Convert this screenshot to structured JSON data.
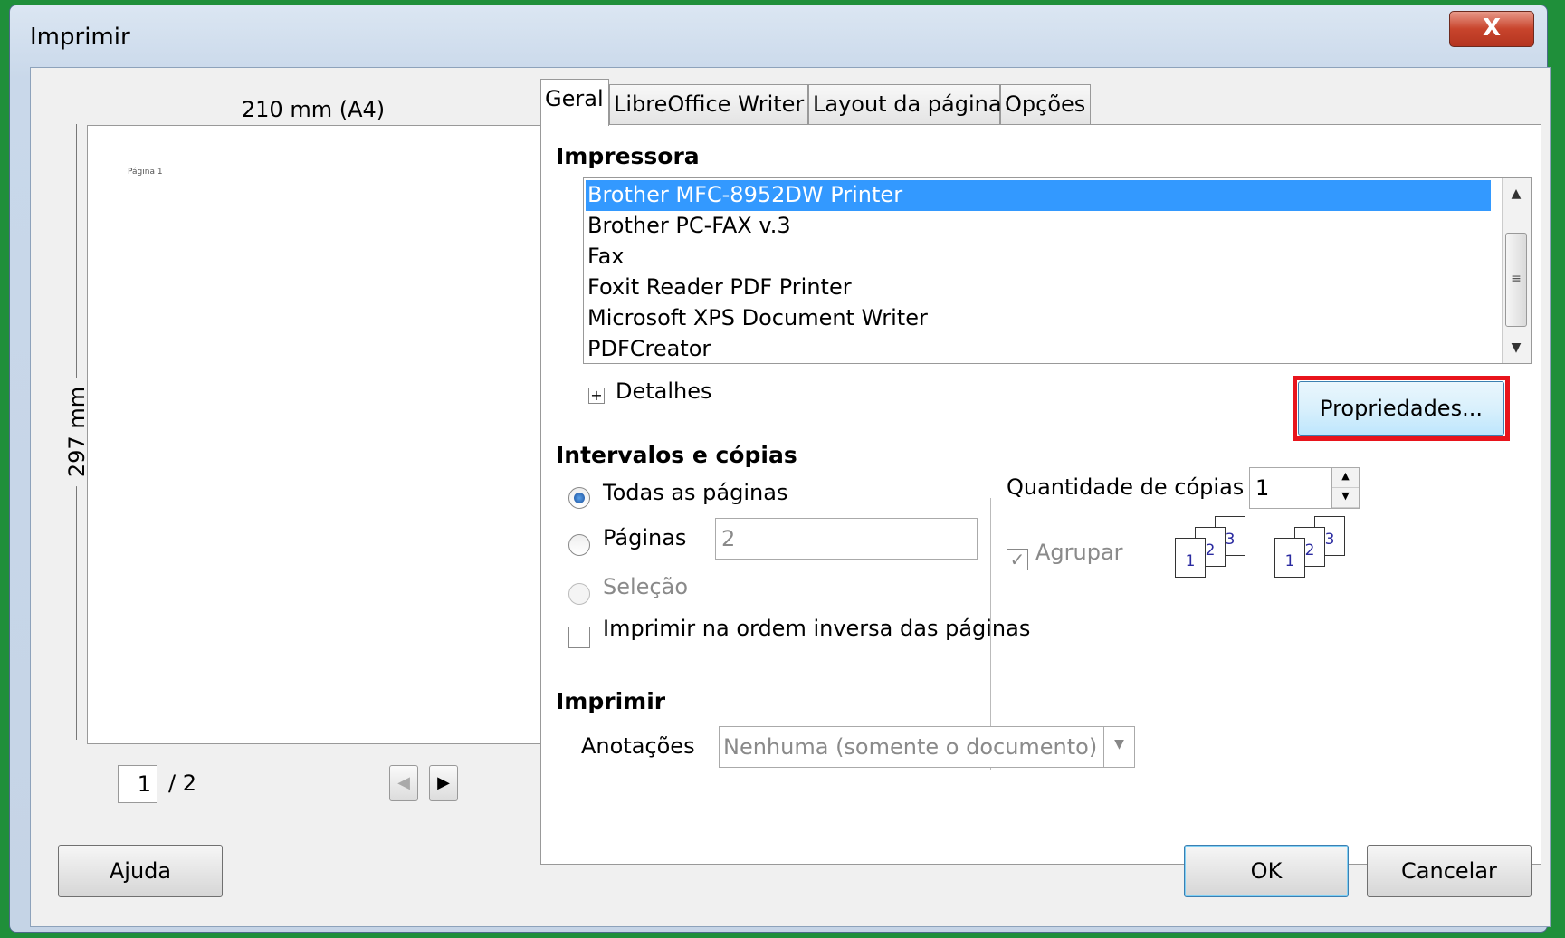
{
  "window": {
    "title": "Imprimir",
    "close_label": "X"
  },
  "preview": {
    "width_label": "210 mm (A4)",
    "height_label": "297 mm",
    "page_text": "Página 1",
    "current_page": "1",
    "total_pages": "/ 2"
  },
  "tabs": [
    {
      "label": "Geral"
    },
    {
      "label": "LibreOffice Writer"
    },
    {
      "label": "Layout da página"
    },
    {
      "label": "Opções"
    }
  ],
  "printer": {
    "section_title": "Impressora",
    "items": [
      "Brother MFC-8952DW Printer",
      "Brother PC-FAX v.3",
      "Fax",
      "Foxit Reader PDF Printer",
      "Microsoft XPS Document Writer",
      "PDFCreator"
    ],
    "selected_index": 0,
    "details_label": "Detalhes",
    "properties_label": "Propriedades..."
  },
  "ranges": {
    "section_title": "Intervalos e cópias",
    "all_pages_label": "Todas as páginas",
    "pages_label": "Páginas",
    "pages_value": "2",
    "selection_label": "Seleção",
    "reverse_label": "Imprimir na ordem inversa das páginas",
    "copies_label": "Quantidade de cópias",
    "copies_value": "1",
    "collate_label": "Agrupar"
  },
  "print_section": {
    "section_title": "Imprimir",
    "annotations_label": "Anotações",
    "annotations_value": "Nenhuma (somente o documento)"
  },
  "footer": {
    "help_label": "Ajuda",
    "ok_label": "OK",
    "cancel_label": "Cancelar"
  },
  "colors": {
    "selection": "#3399ff",
    "highlight_box": "#e8141c",
    "background_outer": "#1f8f3a"
  }
}
